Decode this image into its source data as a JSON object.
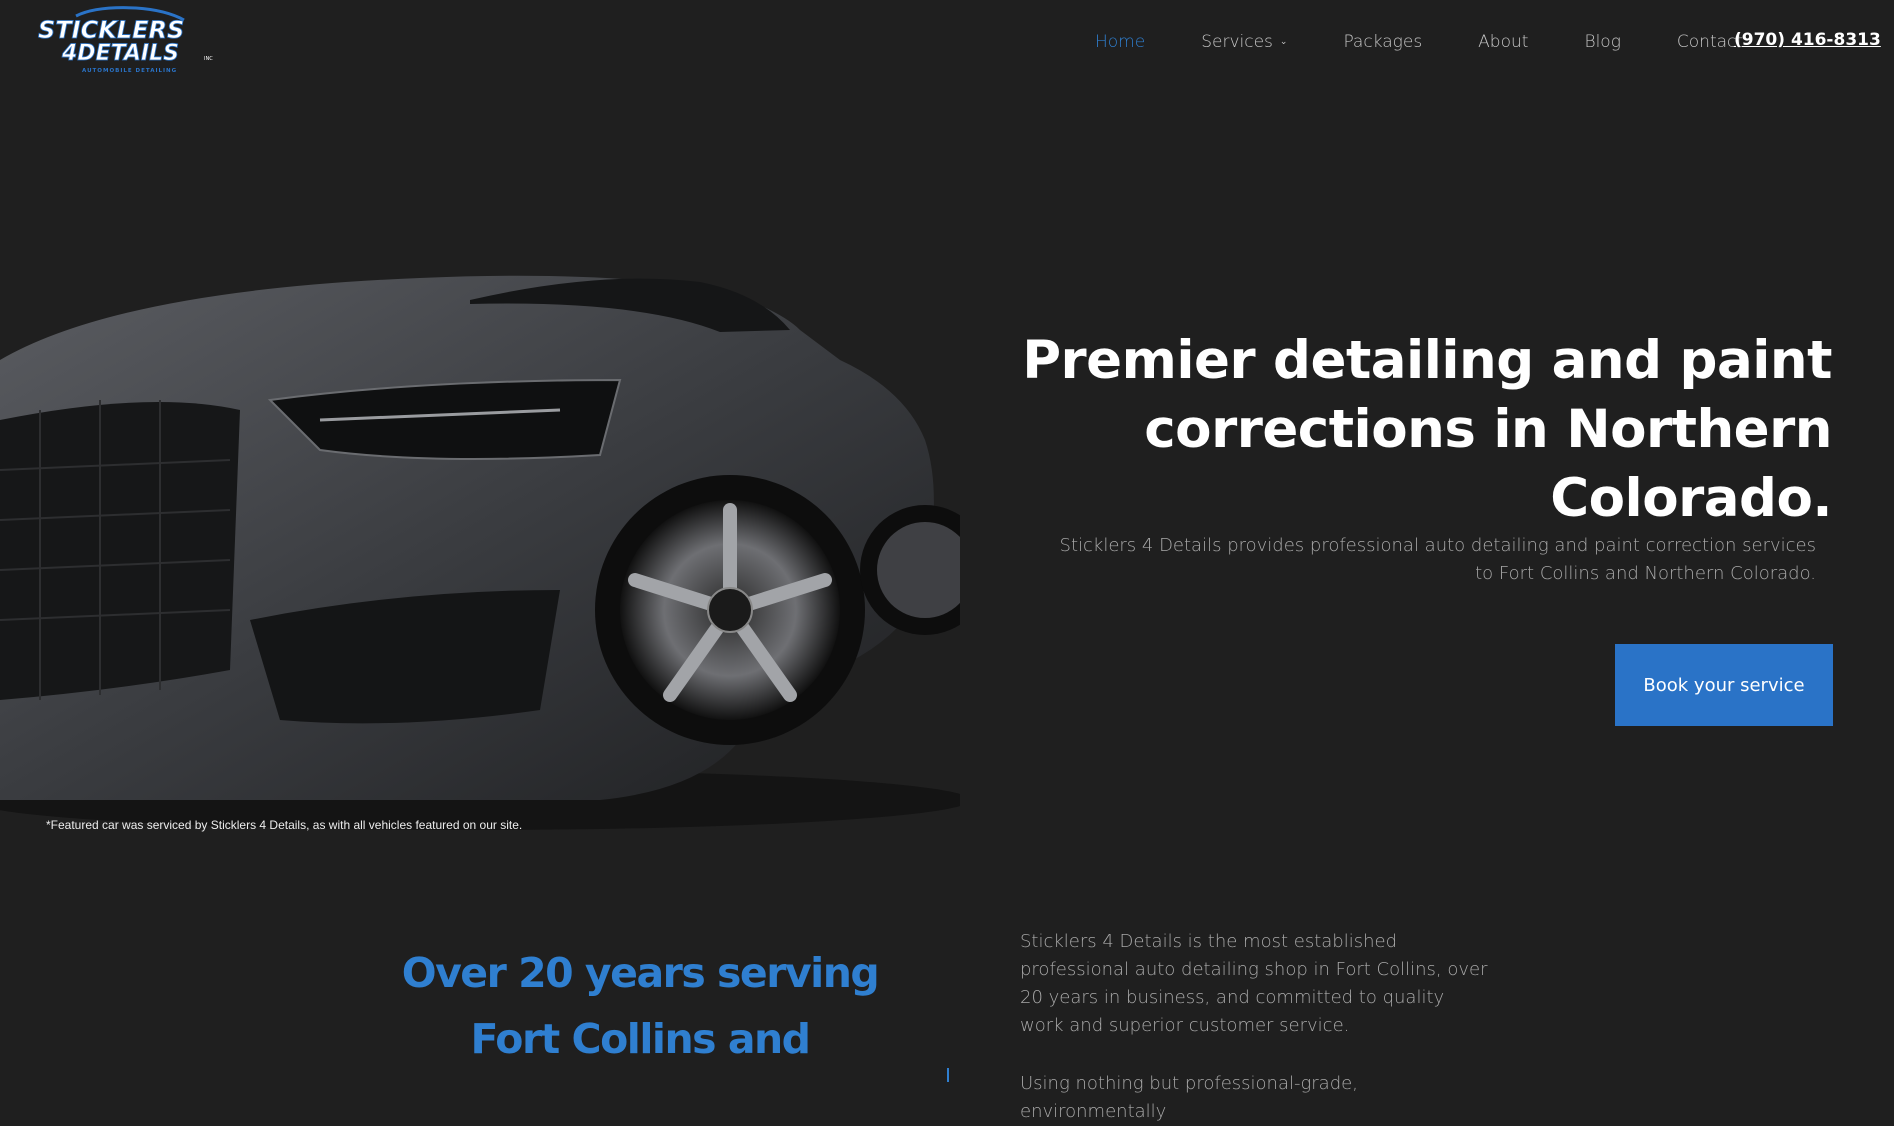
{
  "brand": {
    "logo_line1": "STICKLERS",
    "logo_line2": "4DETAILS",
    "logo_tagline": "AUTOMOBILE DETAILING",
    "logo_mark": "INC",
    "accent_color": "#2a73c7",
    "background_color": "#1f1f1f"
  },
  "nav": {
    "items": [
      {
        "label": "Home",
        "active": true
      },
      {
        "label": "Services",
        "has_dropdown": true
      },
      {
        "label": "Packages"
      },
      {
        "label": "About"
      },
      {
        "label": "Blog"
      },
      {
        "label": "Contact"
      }
    ],
    "phone": "(970) 416-8313"
  },
  "hero": {
    "title": "Premier detailing and paint corrections in Northern Colorado.",
    "subtitle": "Sticklers 4 Details provides professional auto detailing and paint correction services to Fort Collins and Northern Colorado.",
    "cta_label": "Book your service",
    "car_note": "*Featured car was serviced by Sticklers 4 Details, as with all vehicles featured on our site."
  },
  "about": {
    "title": "Over 20 years serving Fort Collins and",
    "paragraph1": "Sticklers 4 Details is the most established professional auto detailing shop in Fort Collins, over 20 years in business, and committed to quality work and superior customer service.",
    "paragraph2": "Using nothing but professional-grade, environmentally"
  },
  "icons": {
    "dropdown": "chevron-down-icon",
    "hero_image": "car-image"
  }
}
